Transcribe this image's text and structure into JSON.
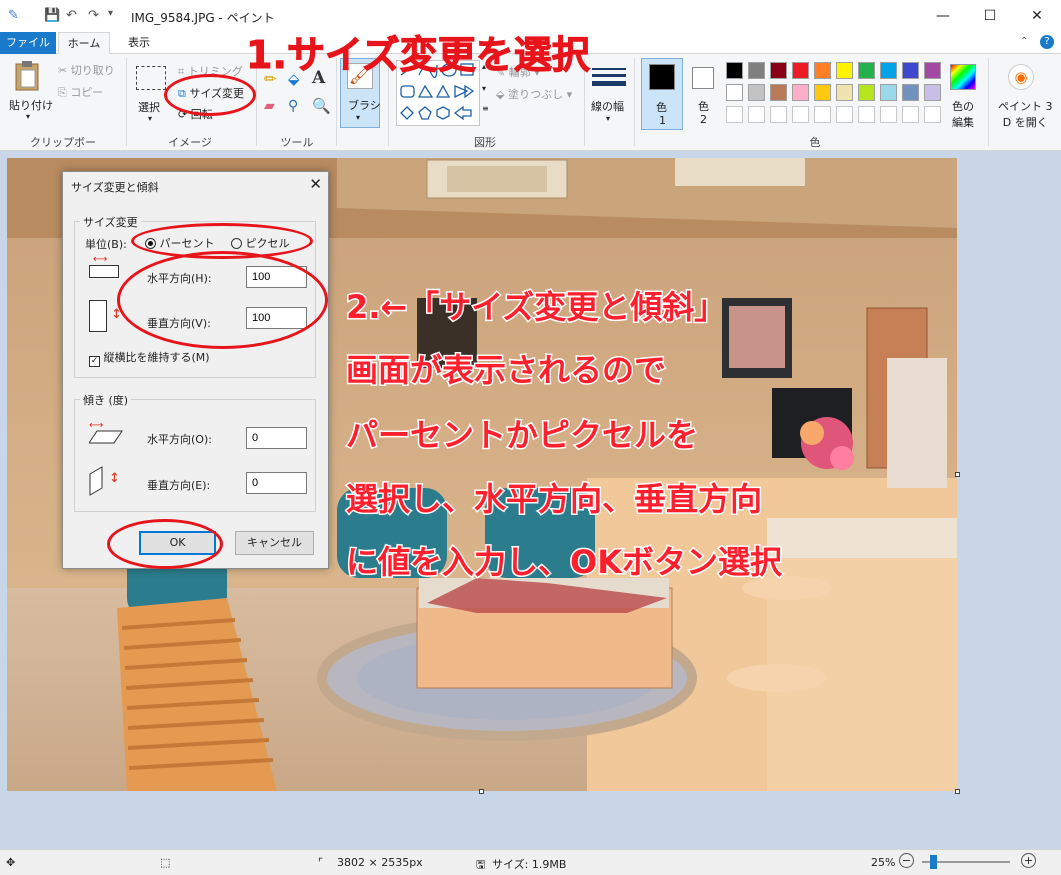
{
  "window": {
    "title": "IMG_9584.JPG - ペイント",
    "minimize": "—",
    "maximize": "☐",
    "close": "✕"
  },
  "tabs": {
    "file": "ファイル",
    "home": "ホーム",
    "view": "表示"
  },
  "ribbon": {
    "clipboard": {
      "paste": "貼り付け",
      "cut": "切り取り",
      "copy": "コピー",
      "label": "クリップボード"
    },
    "image": {
      "select": "選択",
      "crop": "トリミング",
      "resize": "サイズ変更",
      "rotate": "回転",
      "label": "イメージ"
    },
    "tools": {
      "label": "ツール"
    },
    "brush": {
      "label": "ブラシ"
    },
    "shapes": {
      "outline": "輪郭",
      "fill": "塗りつぶし",
      "label": "図形"
    },
    "line_width": {
      "label": "線の幅"
    },
    "colors": {
      "color1": "色",
      "color1_num": "1",
      "color2": "色",
      "color2_num": "2",
      "edit": "色の\n編集",
      "edit_line1": "色の",
      "edit_line2": "編集",
      "label": "色",
      "palette_row1": [
        "#000000",
        "#7f7f7f",
        "#880015",
        "#ed1c24",
        "#ff7f27",
        "#fff200",
        "#22b14c",
        "#00a2e8",
        "#3f48cc",
        "#a349a4"
      ],
      "palette_row2": [
        "#ffffff",
        "#c3c3c3",
        "#b97a57",
        "#ffaec9",
        "#ffc90e",
        "#efe4b0",
        "#b5e61d",
        "#99d9ea",
        "#7092be",
        "#c8bfe7"
      ]
    },
    "paint3d": {
      "line1": "ペイント 3",
      "line2": "D を開く"
    }
  },
  "dialog": {
    "title": "サイズ変更と傾斜",
    "resize_group": "サイズ変更",
    "unit_label": "単位(B):",
    "unit_percent": "パーセント",
    "unit_pixel": "ピクセル",
    "horizontal_label": "水平方向(H):",
    "horizontal_value": "100",
    "vertical_label": "垂直方向(V):",
    "vertical_value": "100",
    "keep_ratio": "縦横比を維持する(M)",
    "skew_group": "傾き (度)",
    "skew_h_label": "水平方向(O):",
    "skew_h_value": "0",
    "skew_v_label": "垂直方向(E):",
    "skew_v_value": "0",
    "ok": "OK",
    "cancel": "キャンセル"
  },
  "annotations": {
    "step1": "1.サイズ変更を選択",
    "step2_lines": [
      "2.←「サイズ変更と傾斜」",
      "画面が表示されるので",
      "パーセントかピクセルを",
      "選択し、水平方向、垂直方向",
      "に値を入力し、OKボタン選択"
    ]
  },
  "statusbar": {
    "dimensions": "3802 × 2535px",
    "size": "サイズ: 1.9MB",
    "zoom": "25%"
  },
  "colors": {
    "accent": "#1979ca",
    "annotation_red": "#e8141b"
  }
}
